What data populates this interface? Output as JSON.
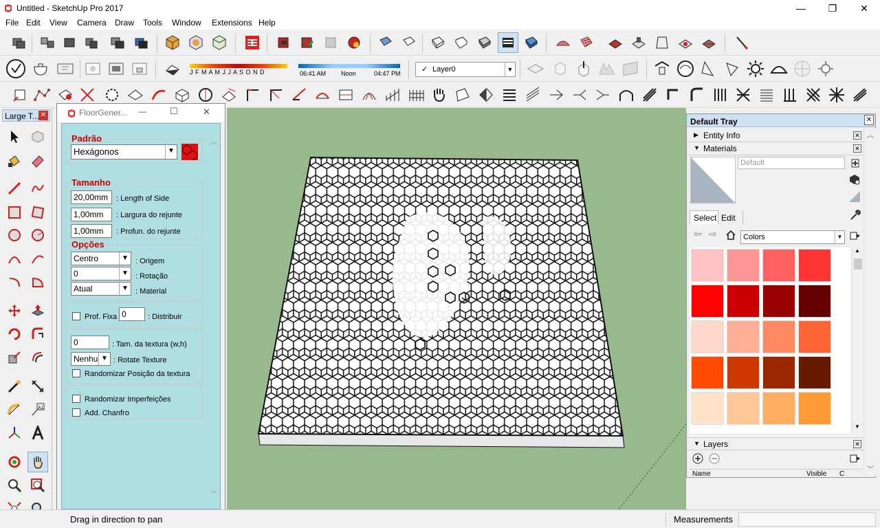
{
  "window": {
    "title": "Untitled - SketchUp Pro 2017",
    "min": "—",
    "max": "❐",
    "close": "✕"
  },
  "menu": [
    "File",
    "Edit",
    "View",
    "Camera",
    "Draw",
    "Tools",
    "Window",
    "Extensions",
    "Help"
  ],
  "shadows": {
    "months": "J F M A M J J A S O N D",
    "time_start": "06:41 AM",
    "time_mid": "Noon",
    "time_end": "04:47 PM"
  },
  "layer": {
    "check": "✓",
    "name": "Layer0"
  },
  "left_toolbar": {
    "title": "Large T...",
    "close": "✕"
  },
  "floor_gen": {
    "title": "FloorGener...",
    "min": "—",
    "max": "☐",
    "close": "✕",
    "padrao": {
      "title": "Padrão",
      "value": "Hexágonos"
    },
    "tamanho": {
      "title": "Tamanho",
      "side": "20,00mm",
      "side_label": ": Length of Side",
      "largura": "1,00mm",
      "largura_label": ": Largura do rejunte",
      "profun": "1,00mm",
      "profun_label": ": Profun. do rejunte"
    },
    "opcoes": {
      "title": "Opções",
      "origem": "Centro",
      "origem_label": ": Origem",
      "rotacao": "0",
      "rotacao_label": ": Rotação",
      "material": "Atual",
      "material_label": ": Material"
    },
    "prof_fixa": "Prof. Fixa",
    "distribuir_value": "0",
    "distribuir_label": ": Distribuir",
    "tex_value": "0",
    "tex_label": ": Tam. da textura (w,h)",
    "rotate_value": "Nenhu",
    "rotate_label": ": Rotate Texture",
    "rand_pos": "Randomizar Posição da textura",
    "rand_imp": "Randomizar Imperfeições",
    "chanfro": "Add. Chanfro"
  },
  "tray": {
    "title": "Default Tray",
    "close": "✕",
    "entity_info": "Entity Info",
    "materials": "Materials",
    "material_name": "Default",
    "tab_select": "Select",
    "tab_edit": "Edit",
    "collection": "Colors",
    "layers": "Layers",
    "col_name": "Name",
    "col_visible": "Visible",
    "col_color": "C"
  },
  "swatches": [
    "#ffc4c4",
    "#ff9696",
    "#ff6262",
    "#ff3434",
    "#ff0000",
    "#cc0000",
    "#990000",
    "#660000",
    "#ffd8cc",
    "#ffae96",
    "#ff8a62",
    "#ff6434",
    "#ff4a00",
    "#cc3a00",
    "#992800",
    "#661a00",
    "#ffe4cc",
    "#ffc896",
    "#ffae62",
    "#ff9a34"
  ],
  "status": {
    "hint": "Drag in direction to pan",
    "measurements": "Measurements"
  }
}
